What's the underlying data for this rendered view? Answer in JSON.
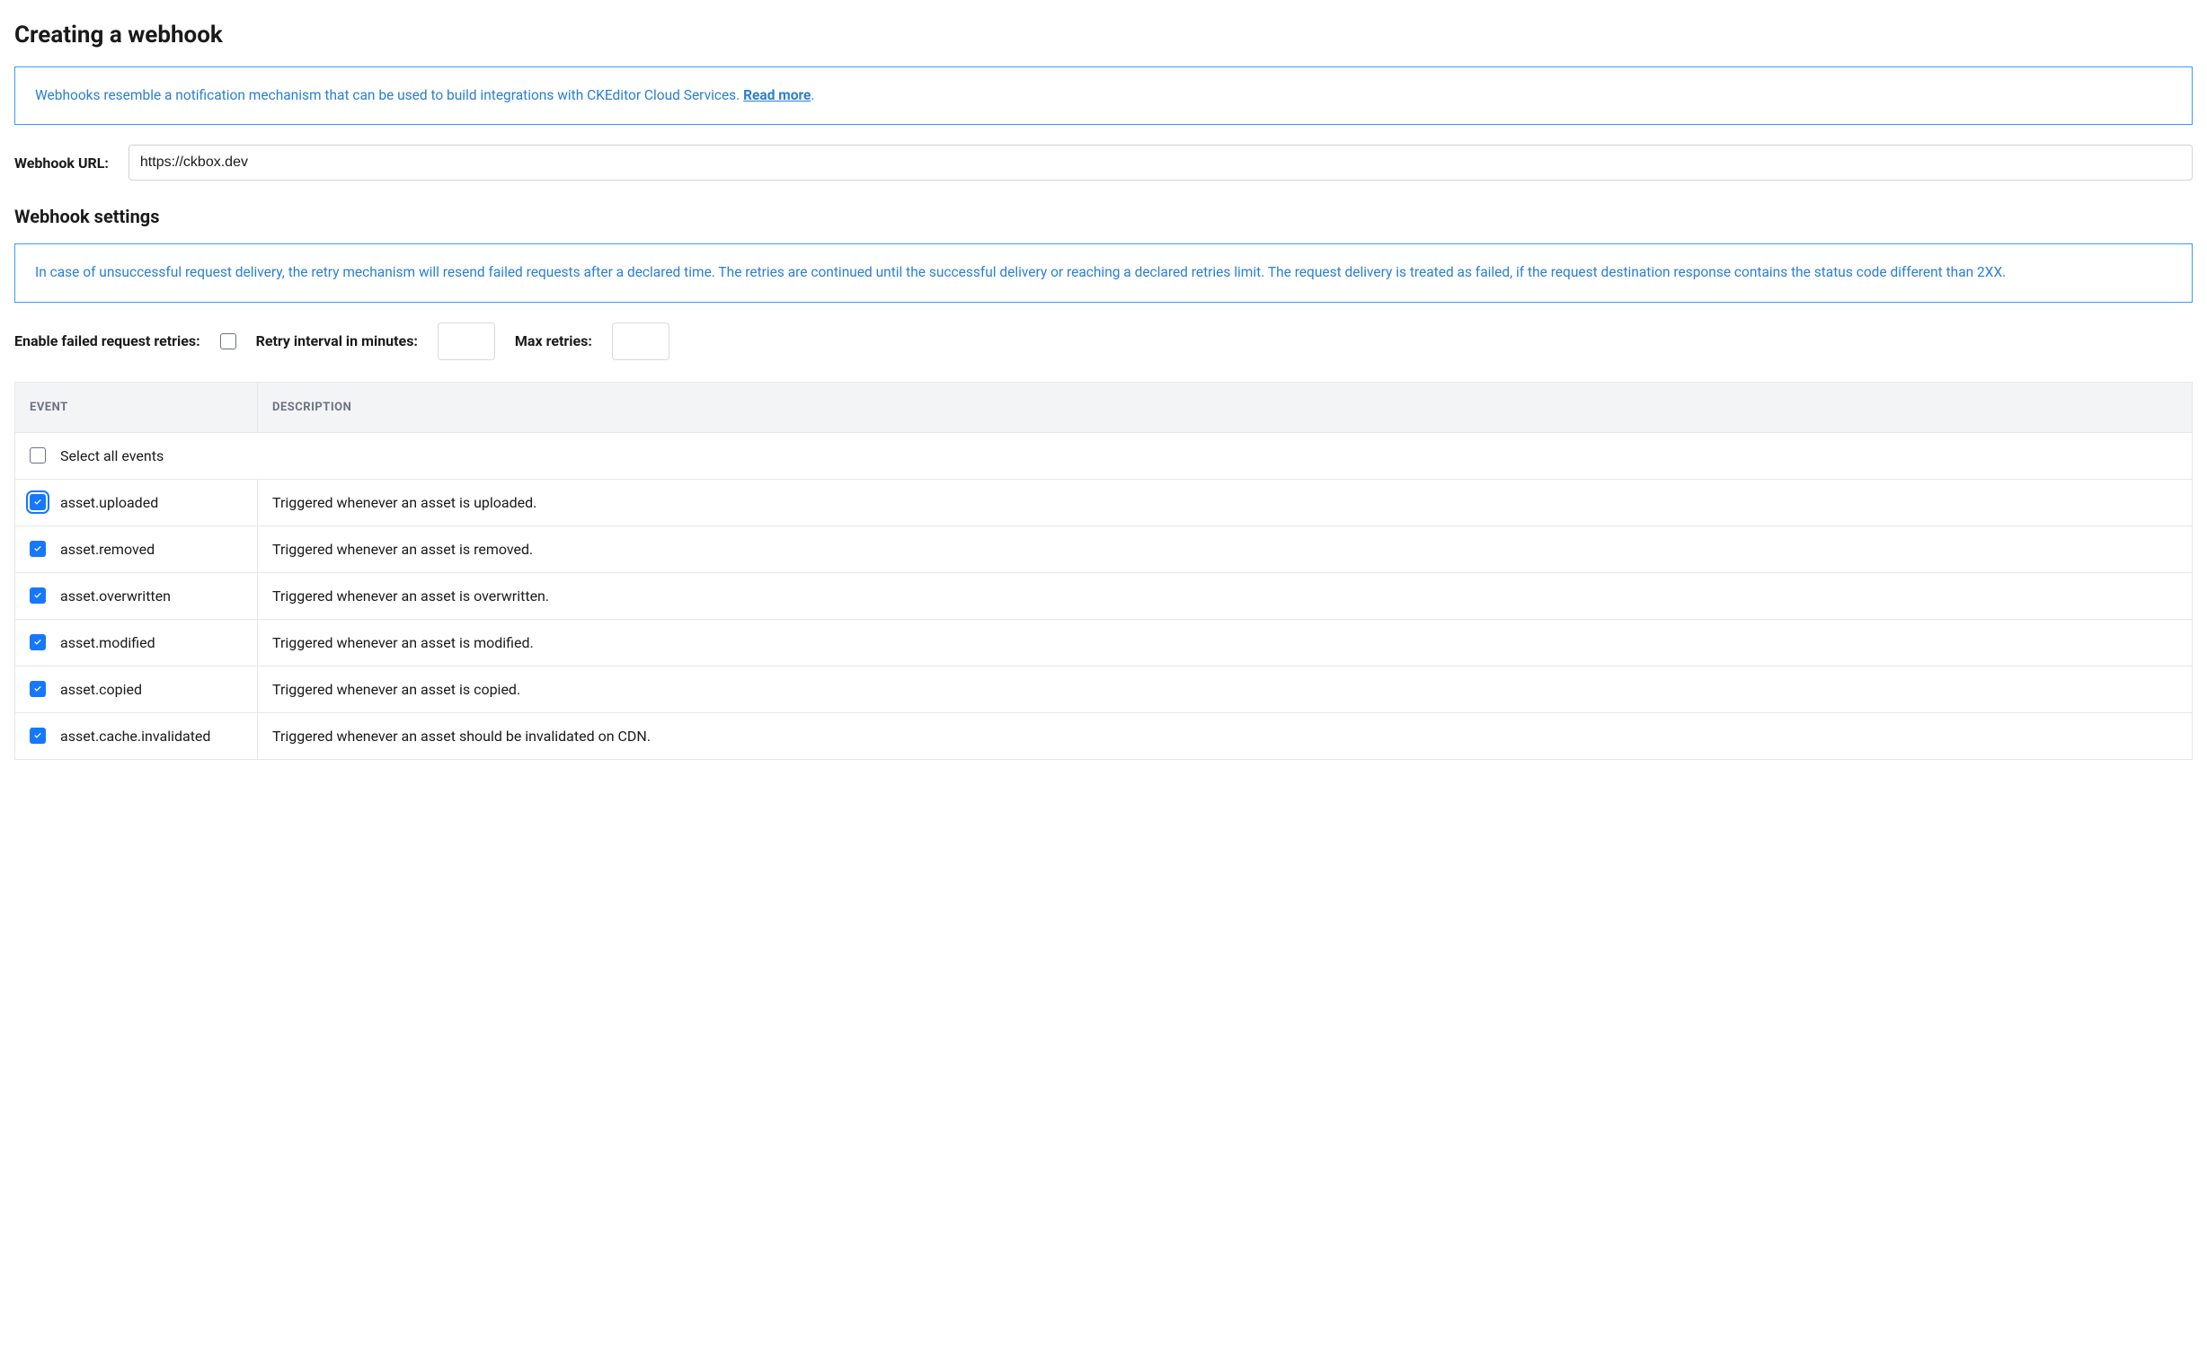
{
  "page_title": "Creating a webhook",
  "info_box_1": {
    "text": "Webhooks resemble a notification mechanism that can be used to build integrations with CKEditor Cloud Services. ",
    "link_text": "Read more",
    "period": "."
  },
  "webhook_url": {
    "label": "Webhook URL:",
    "value": "https://ckbox.dev"
  },
  "settings_title": "Webhook settings",
  "info_box_2": "In case of unsuccessful request delivery, the retry mechanism will resend failed requests after a declared time. The retries are continued until the successful delivery or reaching a declared retries limit. The request delivery is treated as failed, if the request destination response contains the status code different than 2XX.",
  "settings": {
    "enable_retries_label": "Enable failed request retries:",
    "enable_retries_checked": false,
    "retry_interval_label": "Retry interval in minutes:",
    "retry_interval_value": "",
    "max_retries_label": "Max retries:",
    "max_retries_value": ""
  },
  "table": {
    "header_event": "EVENT",
    "header_description": "DESCRIPTION",
    "select_all_label": "Select all events",
    "select_all_checked": false,
    "rows": [
      {
        "name": "asset.uploaded",
        "description": "Triggered whenever an asset is uploaded.",
        "checked": true,
        "focused": true
      },
      {
        "name": "asset.removed",
        "description": "Triggered whenever an asset is removed.",
        "checked": true,
        "focused": false
      },
      {
        "name": "asset.overwritten",
        "description": "Triggered whenever an asset is overwritten.",
        "checked": true,
        "focused": false
      },
      {
        "name": "asset.modified",
        "description": "Triggered whenever an asset is modified.",
        "checked": true,
        "focused": false
      },
      {
        "name": "asset.copied",
        "description": "Triggered whenever an asset is copied.",
        "checked": true,
        "focused": false
      },
      {
        "name": "asset.cache.invalidated",
        "description": "Triggered whenever an asset should be invalidated on CDN.",
        "checked": true,
        "focused": false
      }
    ]
  }
}
